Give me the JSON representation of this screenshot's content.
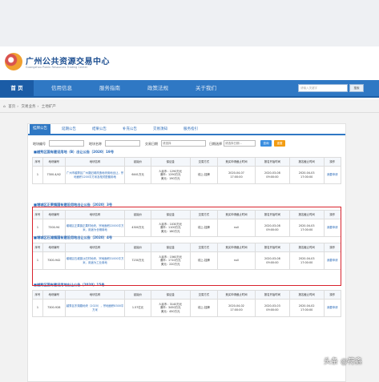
{
  "site": {
    "title": "广州公共资源交易中心",
    "subtitle": "Guangzhou Public Resources Trading Center"
  },
  "nav": {
    "items": [
      {
        "label": "首 页",
        "active": true
      },
      {
        "label": "信用信息"
      },
      {
        "label": "服务指南"
      },
      {
        "label": "政策法规"
      },
      {
        "label": "关于我们"
      }
    ],
    "search_placeholder": "请输入关键字",
    "search_button": "搜索"
  },
  "breadcrumb": [
    "首页",
    "交易业务",
    "土地矿产"
  ],
  "subtabs": [
    "挂牌公告",
    "延期公告",
    "结果公告",
    "补充公告",
    "交易须知",
    "服务指引"
  ],
  "filters": {
    "label1": "地块编号",
    "label2": "地块名称",
    "label3": "交易日期",
    "label4": "日期选择",
    "select_value": "请选择",
    "date_placeholder": "请选择日期...",
    "search_button": "查询",
    "reset_button": "重置"
  },
  "columns": [
    "序号",
    "地块编号",
    "地块名称",
    "起始价",
    "保证金",
    "交易方式",
    "竞买申请截止时间",
    "报名开始时间",
    "报名截止时间",
    "操作"
  ],
  "groups": [
    {
      "title": "■越秀区国有建设用地（B）出让公告〔2020〕19号",
      "rows": [
        {
          "no": "1",
          "code": "7300-4/42",
          "name": "广州市越秀区广州路旧城改造地块用地出让，宗地面积1200平方米及相关配套用地",
          "price": "6441万元",
          "deposit": "人民币：1290万元\n港币：1290万元\n美元：190万元",
          "method": "线上-挂牌",
          "deadline": "2020-04-07\n17:00:00",
          "start": "2020-03-08\n09:00:00",
          "end": "2020-04-03\n17:00:00",
          "action": "我要申请"
        }
      ]
    },
    {
      "title": "■增城区正果镇国有建设用地出让公告〔2020〕3号",
      "rows": [
        {
          "no": "1",
          "code": "7300-94",
          "name": "增城区正果镇正果村地块，宗地面积22000平方米，用途为仓储用地",
          "price": "4300万元",
          "deposit": "人民币：1030万元\n港币：1100万元\n美元：160万元",
          "method": "线上-挂牌",
          "deadline": "null",
          "start": "2020-03-08\n09:00:00",
          "end": "2020-04-03\n17:00:00",
          "action": "我要申请"
        }
      ]
    },
    {
      "title": "■增城区石滩镇国有建设用地出让公告〔2020〕4号",
      "rows": [
        {
          "no": "1",
          "code": "7300-942",
          "name": "增城区石滩镇沙庄村地块，宗地面积31000平方米，用途为工业用地",
          "price": "7230万元",
          "deposit": "人民币：1560万元\n港币：1710万元\n美元：220万元",
          "method": "线上-挂牌",
          "deadline": "null",
          "start": "2020-03-08\n09:00:00",
          "end": "2020-04-03\n17:00:00",
          "action": "我要申请"
        }
      ]
    },
    {
      "title": "■越秀区国有建设用地出让公告〔2020〕15号",
      "rows": [
        {
          "no": "1",
          "code": "7300-928",
          "name": "越秀区东湖路地块（2020），宗地面积8300平方米",
          "price": "1.57亿元",
          "deposit": "人民币：3140万元\n港币：3450万元\n美元：450万元",
          "method": "线上-挂牌",
          "deadline": "2020-04-02\n17:00:00",
          "start": "2020-03-03\n09:00:00",
          "end": "2020-04-02\n17:00:00",
          "action": "我要申请"
        }
      ]
    }
  ],
  "watermark": "头条 @符鑫"
}
